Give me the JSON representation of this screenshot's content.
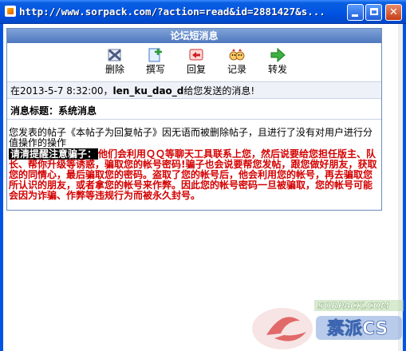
{
  "window": {
    "title": "http://www.sorpack.com/?action=read&id=2881427&s...",
    "min_glyph": "_",
    "close_glyph": "✕"
  },
  "dialog": {
    "header": "论坛短消息",
    "toolbar": [
      {
        "label": "删除",
        "icon": "delete-icon"
      },
      {
        "label": "撰写",
        "icon": "compose-icon"
      },
      {
        "label": "回复",
        "icon": "reply-icon"
      },
      {
        "label": "记录",
        "icon": "history-icon"
      },
      {
        "label": "转发",
        "icon": "forward-icon"
      }
    ],
    "sender_prefix": "在2013-5-7 8:32:00，",
    "sender_name": "len_ku_dao_d",
    "sender_suffix": "给您发送的消息!",
    "subject_label": "消息标题：",
    "subject_value": "系统消息",
    "body_line": "您发表的帖子《本帖子为回复帖子》因无语而被删除帖子，且进行了没有对用户进行分值操作的操作",
    "warning_label": "请清提醒注意骗子：",
    "warning_text": "他们会利用ＱＱ等聊天工具联系上您，然后说要给您担任版主、队长、帮你升级等诱惑，骗取您的帐号密码!骗子也会说要帮您发帖，跟您做好朋友，获取您的同情心，最后骗取您的密码。盗取了您的帐号后，他会利用您的帐号，再去骗取您所认识的朋友，或者拿您的帐号来作弊。因此您的帐号密码一旦被骗取，您的帐号可能会因为诈骗、作弊等违规行为而被永久封号。"
  },
  "watermark": {
    "text": "SORPACK.COM",
    "cn": "素派CS"
  },
  "colors": {
    "titlebar": "#0054e3",
    "panel_header": "#5a82c4",
    "warning": "#d40000"
  }
}
